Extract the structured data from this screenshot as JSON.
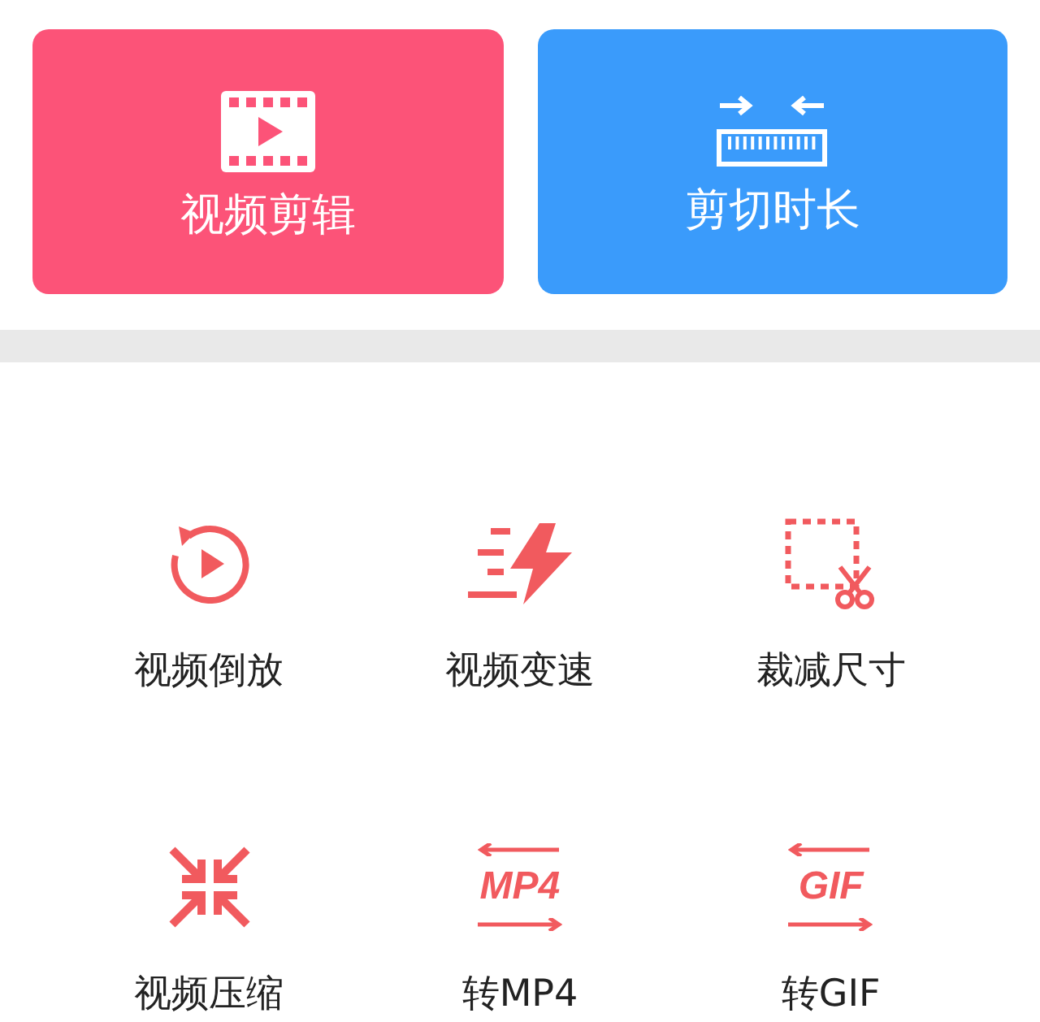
{
  "cards": [
    {
      "label": "视频剪辑",
      "kind": "film",
      "color": "#fc5378"
    },
    {
      "label": "剪切时长",
      "kind": "ruler",
      "color": "#3a9bfb"
    }
  ],
  "tools": [
    {
      "label": "视频倒放",
      "kind": "reverse"
    },
    {
      "label": "视频变速",
      "kind": "speed"
    },
    {
      "label": "裁减尺寸",
      "kind": "crop"
    },
    {
      "label": "视频压缩",
      "kind": "compress"
    },
    {
      "label": "转MP4",
      "kind": "convert",
      "icon_text": "MP4"
    },
    {
      "label": "转GIF",
      "kind": "convert",
      "icon_text": "GIF"
    }
  ]
}
